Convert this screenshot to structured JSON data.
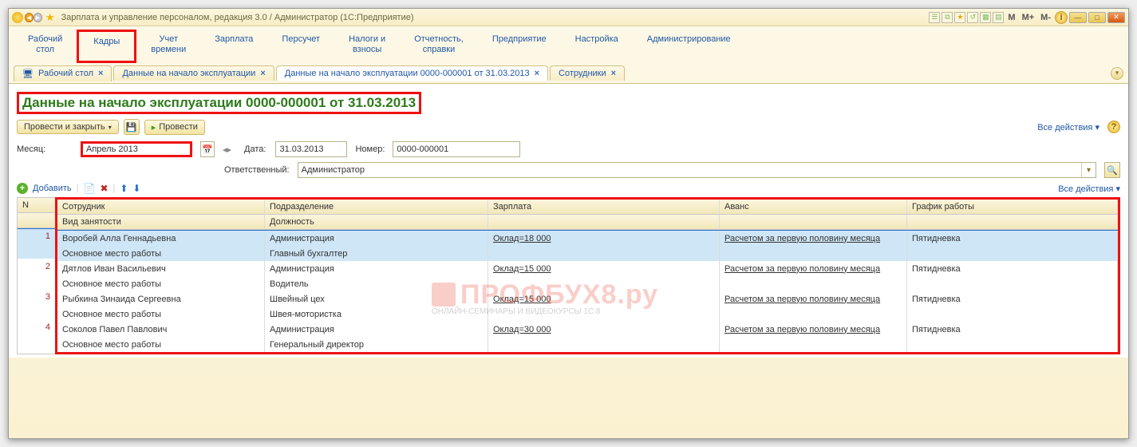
{
  "title": "Зарплата и управление персоналом, редакция 3.0 / Администратор  (1С:Предприятие)",
  "win_buttons": {
    "m": "M",
    "m_plus": "M+",
    "m_minus": "M-"
  },
  "sections": [
    "Рабочий\nстол",
    "Кадры",
    "Учет\nвремени",
    "Зарплата",
    "Персучет",
    "Налоги и\nвзносы",
    "Отчетность,\nсправки",
    "Предприятие",
    "Настройка",
    "Администрирование"
  ],
  "doc_tabs": [
    {
      "label": "Рабочий стол",
      "icon": "desktop-icon"
    },
    {
      "label": "Данные на начало эксплуатации"
    },
    {
      "label": "Данные на начало эксплуатации 0000-000001 от 31.03.2013",
      "active": true
    },
    {
      "label": "Сотрудники"
    }
  ],
  "doc_title": "Данные на начало эксплуатации 0000-000001 от 31.03.2013",
  "toolbar": {
    "post_close": "Провести и закрыть",
    "post": "Провести",
    "all_actions": "Все действия"
  },
  "form": {
    "month_label": "Месяц:",
    "month_value": "Апрель 2013",
    "date_label": "Дата:",
    "date_value": "31.03.2013",
    "number_label": "Номер:",
    "number_value": "0000-000001",
    "resp_label": "Ответственный:",
    "resp_value": "Администратор"
  },
  "tbl_toolbar": {
    "add": "Добавить",
    "all_actions": "Все действия"
  },
  "grid": {
    "headers": {
      "n": "N",
      "employee": "Сотрудник",
      "employment": "Вид занятости",
      "department": "Подразделение",
      "position": "Должность",
      "salary": "Зарплата",
      "advance": "Аванс",
      "schedule": "График работы"
    },
    "rows": [
      {
        "n": "1",
        "employee": "Воробей Алла Геннадьевна",
        "employment": "Основное место работы",
        "department": "Администрация",
        "position": "Главный бухгалтер",
        "salary": "Оклад=18 000",
        "advance": "Расчетом за первую половину месяца",
        "schedule": "Пятидневка",
        "selected": true
      },
      {
        "n": "2",
        "employee": "Дятлов Иван Васильевич",
        "employment": "Основное место работы",
        "department": "Администрация",
        "position": "Водитель",
        "salary": "Оклад=15 000",
        "advance": "Расчетом за первую половину месяца",
        "schedule": "Пятидневка"
      },
      {
        "n": "3",
        "employee": "Рыбкина Зинаида Сергеевна",
        "employment": "Основное место работы",
        "department": "Швейный цех",
        "position": "Швея-мотористка",
        "salary": "Оклад=15 000",
        "advance": "Расчетом за первую половину месяца",
        "schedule": "Пятидневка"
      },
      {
        "n": "4",
        "employee": "Соколов Павел Павлович",
        "employment": "Основное место работы",
        "department": "Администрация",
        "position": "Генеральный директор",
        "salary": "Оклад=30 000",
        "advance": "Расчетом за первую половину месяца",
        "schedule": "Пятидневка"
      }
    ]
  },
  "watermark": {
    "text": "ПРОФБУХ8.ру",
    "sub": "ОНЛАЙН-СЕМИНАРЫ И ВИДЕОКУРСЫ 1С:8"
  }
}
